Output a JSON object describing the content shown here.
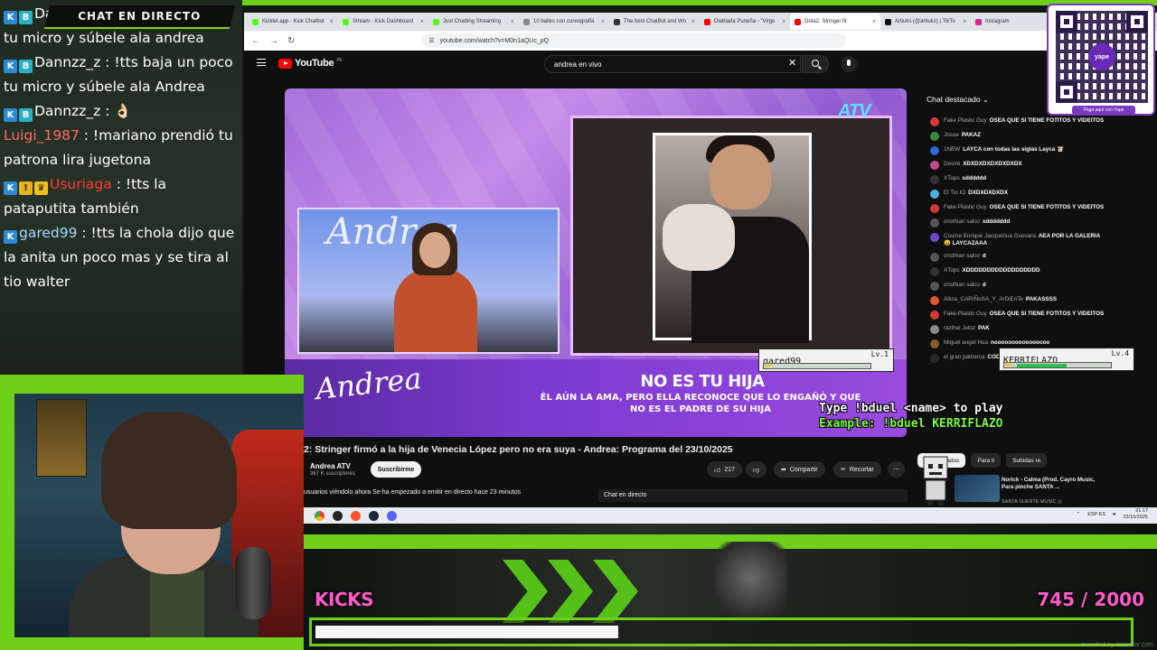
{
  "stream_chat": {
    "header": "CHAT EN DIRECTO",
    "messages": [
      {
        "user": "Dannzz_z",
        "text": "!tts baja un poco tu micro y súbele ala andrea",
        "color": "#ffffff",
        "badges": [
          "kick",
          "b"
        ]
      },
      {
        "user": "Dannzz_z",
        "text": "!tts baja un poco tu micro y súbele ala Andrea",
        "color": "#ffffff",
        "badges": [
          "kick",
          "b"
        ]
      },
      {
        "user": "Dannzz_z",
        "text": "👌🏻",
        "color": "#ffffff",
        "badges": [
          "kick",
          "b"
        ]
      },
      {
        "user": "Luigi_1987",
        "text": "!mariano prendió tu patrona lira jugetona",
        "color": "#ff6a6a",
        "badges": []
      },
      {
        "user": "Usuriaga",
        "text": "!tts la pataputita también",
        "color": "#ff3a3a",
        "badges": [
          "kick",
          "gift",
          "crown"
        ]
      },
      {
        "user": "gared99",
        "text": "!tts la chola dijo que la anita un poco mas y se tira al tio walter",
        "color": "#a8d8ff",
        "badges": [
          "kick"
        ]
      }
    ]
  },
  "browser": {
    "tabs": [
      {
        "label": "Kicklet.app - Kick Chatbot",
        "color": "#53fc18"
      },
      {
        "label": "Stream - Kick Dashboard",
        "color": "#53fc18"
      },
      {
        "label": "Just Chatting Streaming",
        "color": "#53fc18"
      },
      {
        "label": "10 bailes con coreografía",
        "color": "#888888"
      },
      {
        "label": "The best ChatBot and Wo",
        "color": "#333333"
      },
      {
        "label": "Diablada Puneña - \"Virge",
        "color": "#ff0000"
      },
      {
        "label": "Dota2: Stringer fir",
        "color": "#ff0000",
        "active": true
      },
      {
        "label": "Artiuks (@artiuks) | TikTo",
        "color": "#111111"
      },
      {
        "label": "Instagram",
        "color": "#d6249f"
      }
    ],
    "url": "youtube.com/watch?v=M0n1aQUc_pQ"
  },
  "youtube": {
    "logo": "YouTube",
    "country": "PE",
    "search_value": "andrea en vivo",
    "video": {
      "channel_bug": "ATV",
      "studio_logo": "Andrea",
      "show_logo": "Andrea",
      "headline": "NO ES TU HIJA",
      "subheadline": "ÉL AÚN LA AMA, PERO ELLA RECONOCE QUE LO ENGAÑÓ Y QUE NO ES EL PADRE DE SU HIJA"
    },
    "title": "2: Stringer firmó a la hija de Venecia López pero no era suya - Andrea: Programa del 23/10/2025",
    "channel": {
      "name": "Andrea ATV",
      "subs": "367 K suscriptores",
      "subscribe": "Suscribirme"
    },
    "actions": {
      "likes": "217",
      "share": "Compartir",
      "clip": "Recortar"
    },
    "views_line": "usuarios viéndolo ahora  Se ha empezado a emitir en directo hace 23 minutos",
    "live_chat_tab": "Chat en directo",
    "chat_panel": {
      "title": "Chat destacado",
      "messages": [
        {
          "name": "Fake Plastic Guy",
          "text": "OSEA QUE SI TIENE FOTITOS Y VIDEITOS",
          "av": "#d23a3a"
        },
        {
          "name": "Josue",
          "text": "PAKAZ",
          "av": "#3a8a3a"
        },
        {
          "name": "1NEW",
          "text": "LAYCA con todas las siglas Layca 🐮",
          "av": "#2a6ad8"
        },
        {
          "name": "Desiré",
          "text": "XDXDXDXDXDXDXDX",
          "av": "#c04a8a"
        },
        {
          "name": "XTops",
          "text": "xdddddd",
          "av": "#333333"
        },
        {
          "name": "El Tio IO",
          "text": "DXDXDXDXDX",
          "av": "#4ab0e0"
        },
        {
          "name": "Fake Plastic Guy",
          "text": "OSEA QUE SI TIENE FOTITOS Y VIDEITOS",
          "av": "#d23a3a"
        },
        {
          "name": "cristhian salco",
          "text": "xddddddd",
          "av": "#555555"
        },
        {
          "name": "Cosme Enrique Jacquehua Guevara",
          "text": "AEA POR LA GALERIA 😄 LAYCAZAAA",
          "av": "#6a4ac8"
        },
        {
          "name": "cristhian salco",
          "text": "d",
          "av": "#555555"
        },
        {
          "name": "XTops",
          "text": "XDDDDDDDDDDDDDDDDDD",
          "av": "#333333"
        },
        {
          "name": "cristhian salco",
          "text": "d",
          "av": "#555555"
        },
        {
          "name": "Alicia_CARIÑoSA_Y_ArDiEnTe",
          "text": "PAKASSSS",
          "av": "#e05a2a"
        },
        {
          "name": "Fake Plastic Guy",
          "text": "OSEA QUE SI TIENE FOTITOS Y VIDEITOS",
          "av": "#d23a3a"
        },
        {
          "name": "razihel Jeloz",
          "text": "PAK",
          "av": "#8a8a8a"
        },
        {
          "name": "Miguel angel Hua",
          "text": "noooooooooooooooo",
          "av": "#8a5a2a"
        },
        {
          "name": "el gran patriarca",
          "text": "CODIGO ROBOTIN",
          "av": "#2a2a2a"
        }
      ]
    },
    "rec_chips": [
      "Relacionados",
      "Para ti",
      "Subidas re"
    ],
    "rec_item": {
      "title": "Norick - Calma (Prod. Cayro Music, Para pinche SANTA ...",
      "channel": "SANTA SUERTE MUSIC ◎"
    }
  },
  "taskbar": {
    "lang": "ESP ES",
    "time": "21:17",
    "date": "23/10/2025"
  },
  "qr": {
    "center": "yape",
    "caption": "Paga aquí con Yape"
  },
  "duel": {
    "player1": {
      "name": "gared99",
      "level": "Lv.1",
      "hp_label": "HP:",
      "hp": 0.0
    },
    "player2": {
      "name": "KERRIFLAZO",
      "level": "Lv.4",
      "hp_label": "HP:",
      "hp": 0.55
    },
    "help_line1": "Type !bduel <name> to play",
    "help_line2": "Example: !bduel KERRIFLAZO"
  },
  "kicks": {
    "label": "KICKS",
    "count": "745  / 2000",
    "current": 745,
    "goal": 2000
  },
  "watermark": "recorded by mirinstar.com"
}
